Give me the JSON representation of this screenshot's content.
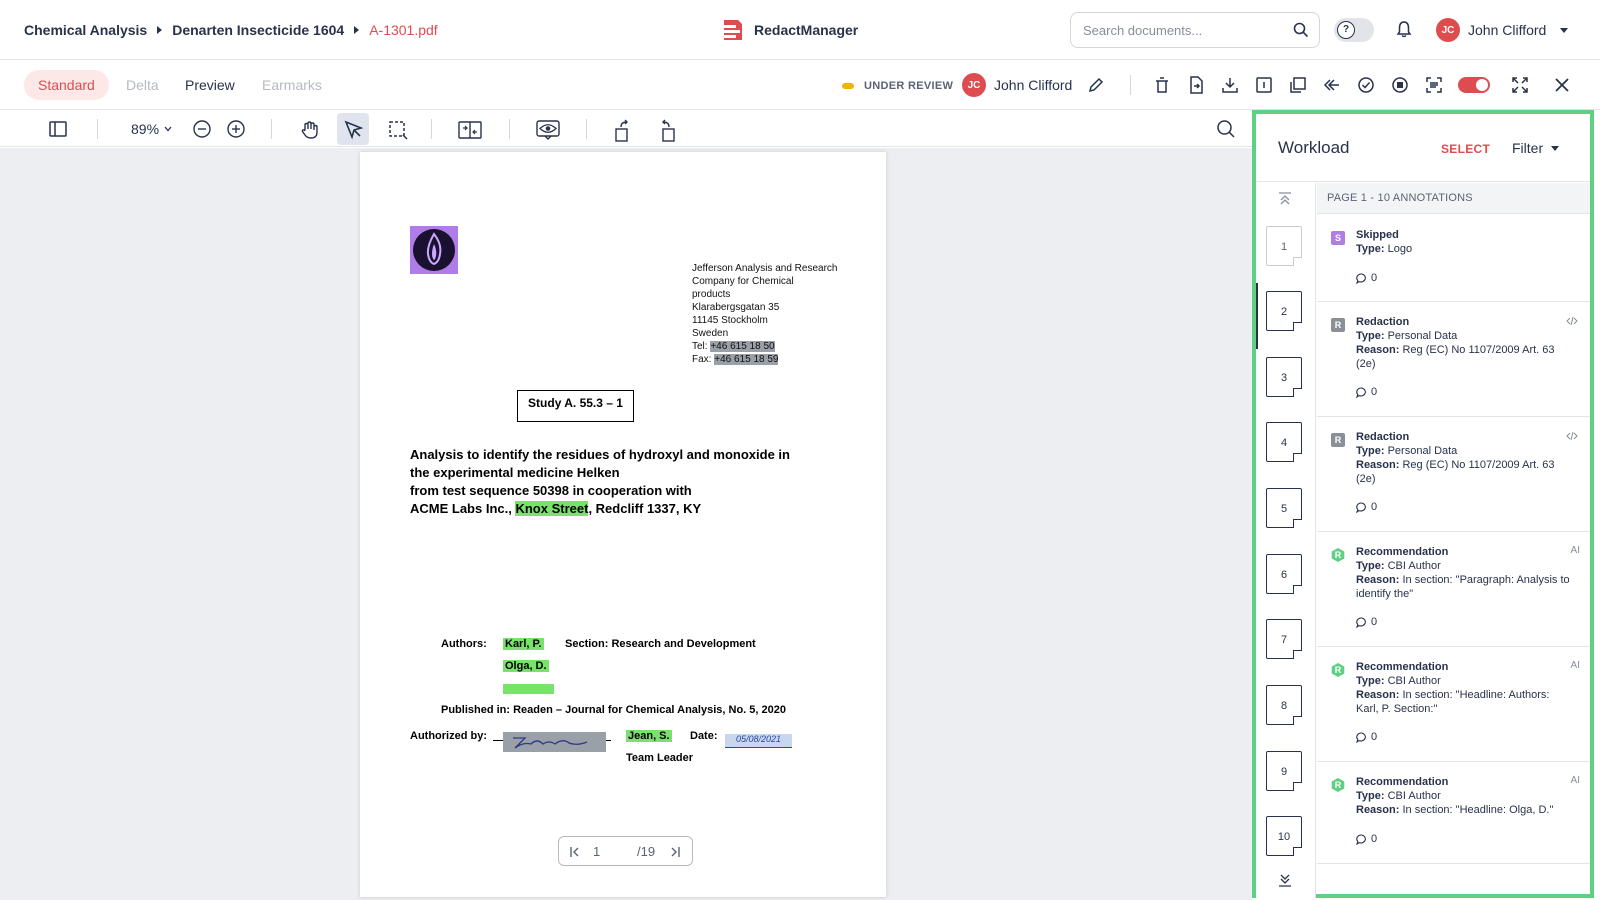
{
  "breadcrumb": {
    "items": [
      "Chemical Analysis",
      "Denarten Insecticide 1604"
    ],
    "file": "A-1301.pdf"
  },
  "app": {
    "name": "RedactManager"
  },
  "search": {
    "placeholder": "Search documents..."
  },
  "user": {
    "initials": "JC",
    "name": "John Clifford"
  },
  "view_tabs": {
    "standard": "Standard",
    "delta": "Delta",
    "preview": "Preview",
    "earmarks": "Earmarks"
  },
  "status": {
    "label": "UNDER REVIEW",
    "color": "#f0b400"
  },
  "assignee": {
    "initials": "JC",
    "name": "John Clifford"
  },
  "viewer": {
    "zoom": "89%"
  },
  "document": {
    "address": [
      "Jefferson Analysis and Research",
      "Company for Chemical",
      "products",
      "Klarabergsgatan 35",
      "11145 Stockholm",
      "Sweden"
    ],
    "tel_label": "Tel:",
    "tel": "+46 615 18 50",
    "fax_label": "Fax:",
    "fax": "+46 615 18 59",
    "study": "Study A. 55.3 – 1",
    "title_lines": [
      "Analysis to identify the residues of hydroxyl and monoxide in",
      "the experimental medicine Helken",
      "from test sequence 50398 in cooperation with"
    ],
    "title_last_pre": "ACME Labs Inc., ",
    "title_last_hl": "Knox Street",
    "title_last_post": ", Redcliff 1337, KY",
    "authors_label": "Authors:",
    "author1": "Karl, P.",
    "author2": "Olga, D.",
    "section": "Section: Research and Development",
    "published": "Published in: Readen – Journal for Chemical Analysis, No. 5, 2020",
    "authorized_label": "Authorized by:",
    "signer": "Jean, S.",
    "date_label": "Date:",
    "date_value": "05/08/2021",
    "role": "Team Leader"
  },
  "pager": {
    "current": "1",
    "total": "/19"
  },
  "workload": {
    "title": "Workload",
    "select": "SELECT",
    "filter": "Filter",
    "page_header": "PAGE 1 - 10 ANNOTATIONS",
    "pages": [
      "1",
      "2",
      "3",
      "4",
      "5",
      "6",
      "7",
      "8",
      "9",
      "10"
    ],
    "annotations": [
      {
        "badge": "S",
        "name": "Skipped",
        "type_label": "Type:",
        "type": "Logo",
        "comments": "0"
      },
      {
        "badge": "R",
        "name": "Redaction",
        "type_label": "Type:",
        "type": "Personal Data",
        "reason_label": "Reason:",
        "reason": "Reg (EC) No 1107/2009 Art. 63 (2e)",
        "comments": "0"
      },
      {
        "badge": "R",
        "name": "Redaction",
        "type_label": "Type:",
        "type": "Personal Data",
        "reason_label": "Reason:",
        "reason": "Reg (EC) No 1107/2009 Art. 63 (2e)",
        "comments": "0"
      },
      {
        "badge": "R",
        "name": "Recommendation",
        "type_label": "Type:",
        "type": "CBI Author",
        "reason_label": "Reason:",
        "reason": "In section: \"Paragraph: Analysis to identify the\"",
        "comments": "0",
        "tag": "AI"
      },
      {
        "badge": "R",
        "name": "Recommendation",
        "type_label": "Type:",
        "type": "CBI Author",
        "reason_label": "Reason:",
        "reason": "In section: \"Headline: Authors: Karl, P. Section:\"",
        "comments": "0",
        "tag": "AI"
      },
      {
        "badge": "R",
        "name": "Recommendation",
        "type_label": "Type:",
        "type": "CBI Author",
        "reason_label": "Reason:",
        "reason": "In section: \"Headline: Olga, D.\"",
        "comments": "0",
        "tag": "AI"
      }
    ]
  },
  "colors": {
    "accent": "#dd4d50",
    "highlight_green": "#78e26a",
    "panel_border": "#5fd083"
  }
}
